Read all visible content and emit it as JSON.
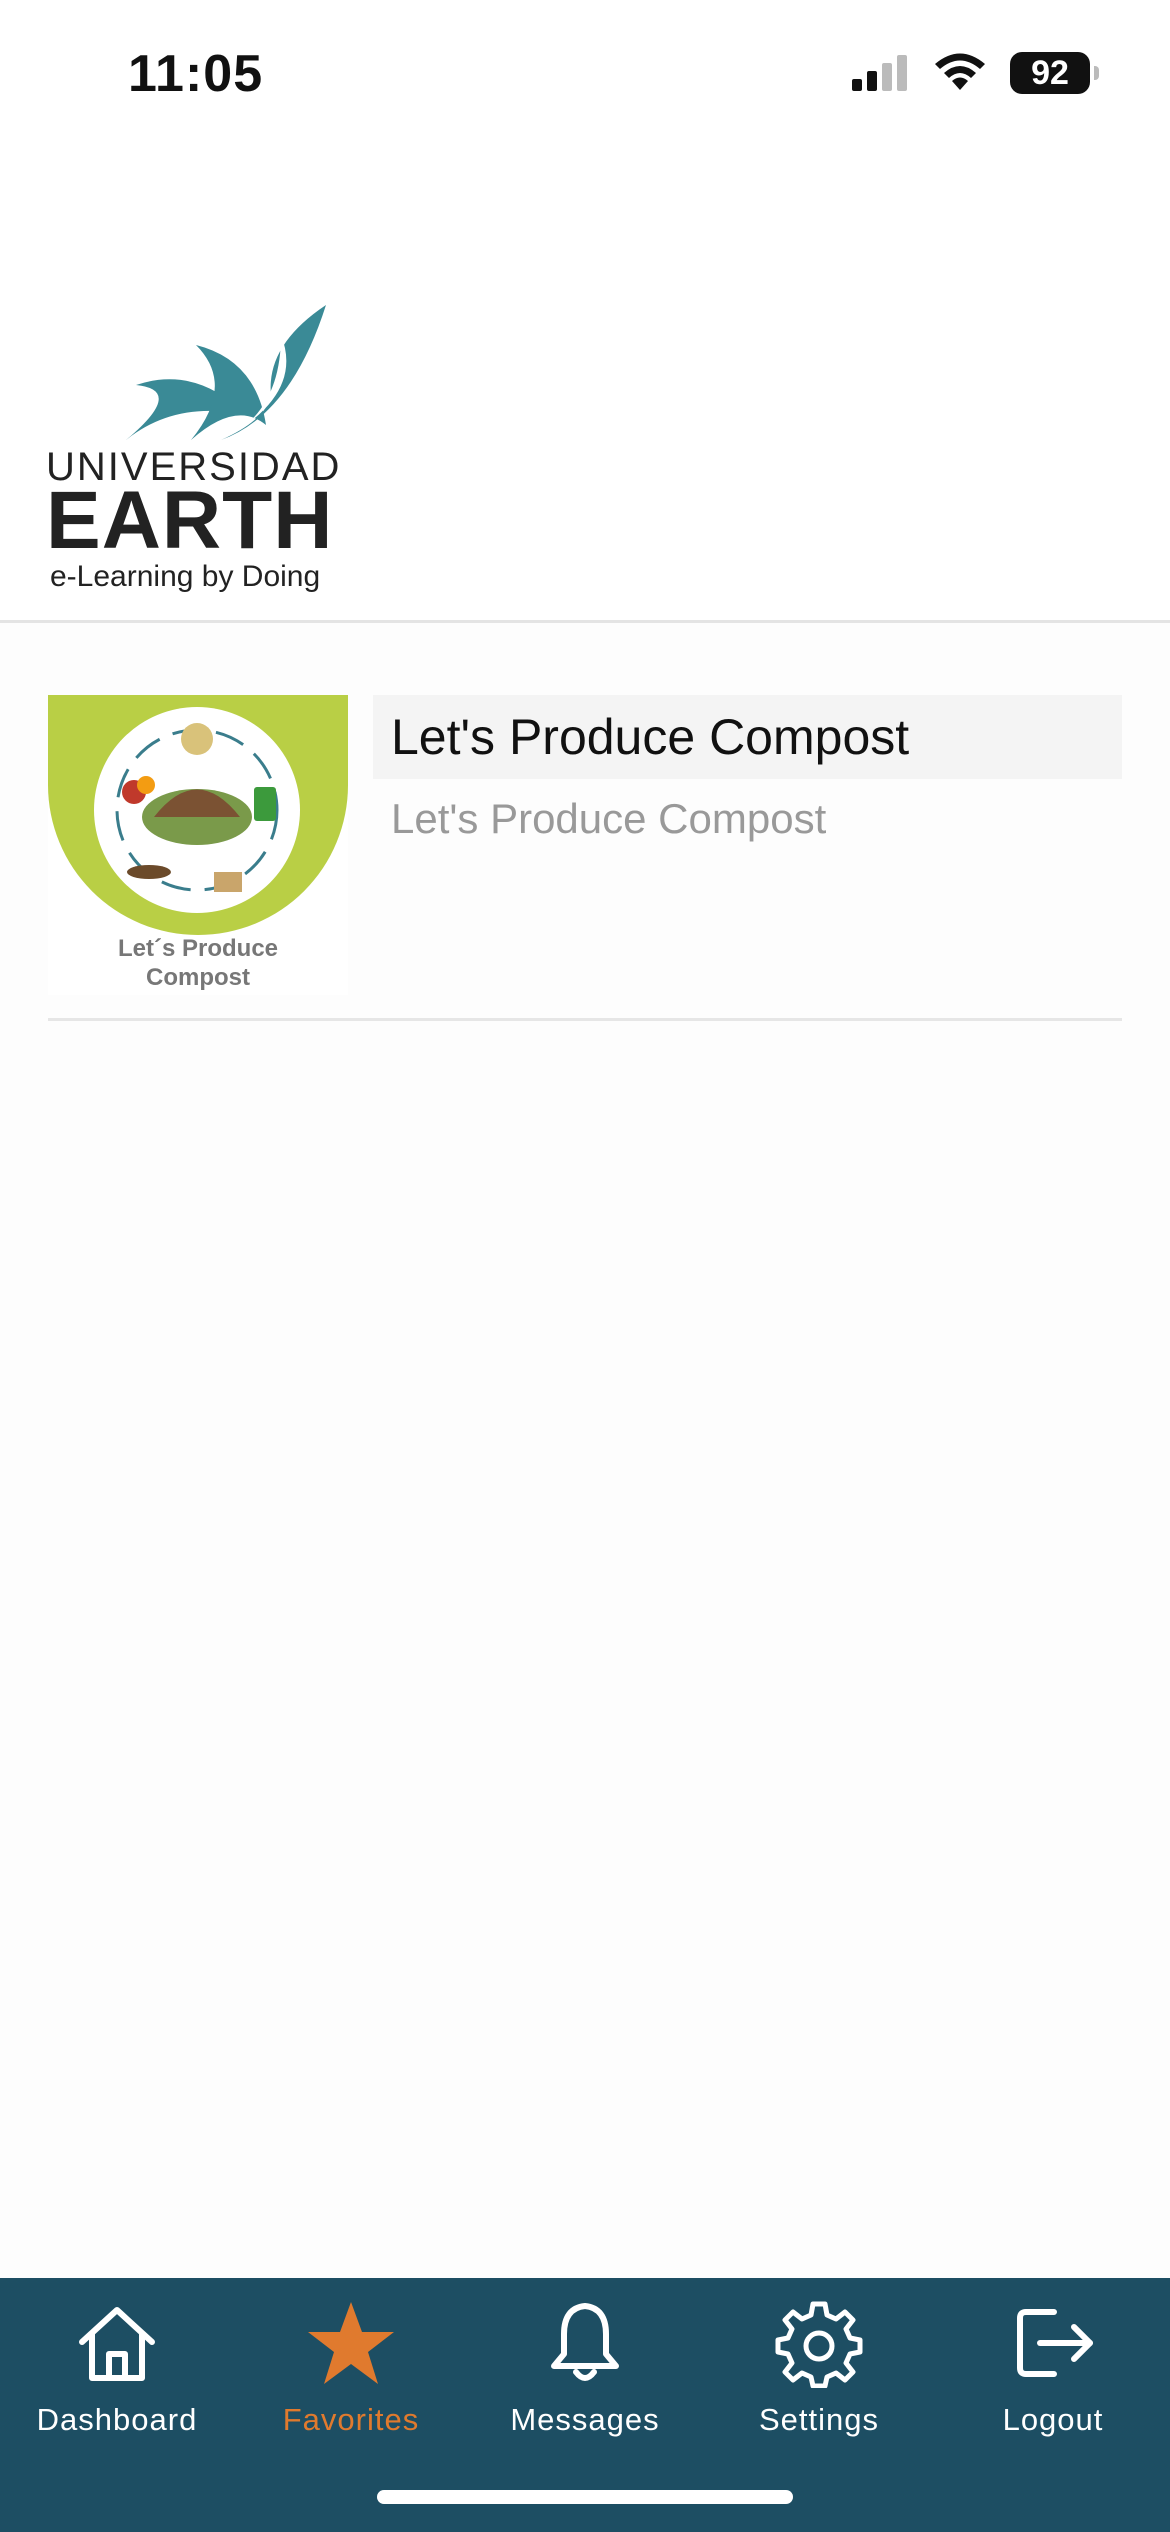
{
  "status_bar": {
    "time": "11:05",
    "battery": "92",
    "signal_icon": "cellular-signal-icon",
    "wifi_icon": "wifi-icon"
  },
  "logo": {
    "line1": "UNIVERSIDAD",
    "line2": "EARTH",
    "line3": "e-Learning by Doing",
    "brand_color": "#3a8a96"
  },
  "courses": [
    {
      "title": "Let's Produce Compost",
      "subtitle": "Let's Produce Compost",
      "thumb_caption_line1": "Let´s Produce",
      "thumb_caption_line2": "Compost"
    }
  ],
  "tabbar": {
    "background": "#1d4e63",
    "active_color": "#e07a2e",
    "items": [
      {
        "label": "Dashboard",
        "icon": "home-icon"
      },
      {
        "label": "Favorites",
        "icon": "star-icon",
        "active": true
      },
      {
        "label": "Messages",
        "icon": "bell-icon"
      },
      {
        "label": "Settings",
        "icon": "gear-icon"
      },
      {
        "label": "Logout",
        "icon": "logout-icon"
      }
    ]
  }
}
